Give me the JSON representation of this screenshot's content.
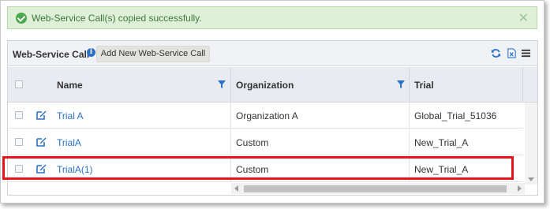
{
  "alert": {
    "message": "Web-Service Call(s) copied successfully.",
    "close_glyph": "✕",
    "icon": "check-circle-icon",
    "color": "#3c763d"
  },
  "toolbar": {
    "title": "Web-Service Call",
    "info_glyph": "i",
    "add_button_label": "Add New Web-Service Call",
    "icons": [
      "info-icon",
      "refresh-icon",
      "excel-export-icon",
      "menu-icon"
    ]
  },
  "grid": {
    "columns": [
      {
        "label": "Name",
        "filter": true
      },
      {
        "label": "Organization",
        "filter": true
      },
      {
        "label": "Trial",
        "filter": false
      }
    ],
    "rows": [
      {
        "name": "Trial A",
        "organization": "Organization A",
        "trial": "Global_Trial_51036"
      },
      {
        "name": "TrialA",
        "organization": "Custom",
        "trial": "New_Trial_A"
      },
      {
        "name": "TrialA(1)",
        "organization": "Custom",
        "trial": "New_Trial_A",
        "highlighted": true
      }
    ]
  },
  "colors": {
    "link": "#2a72c8",
    "highlight_border": "#e8131b",
    "success_bg": "#dff0d8"
  }
}
